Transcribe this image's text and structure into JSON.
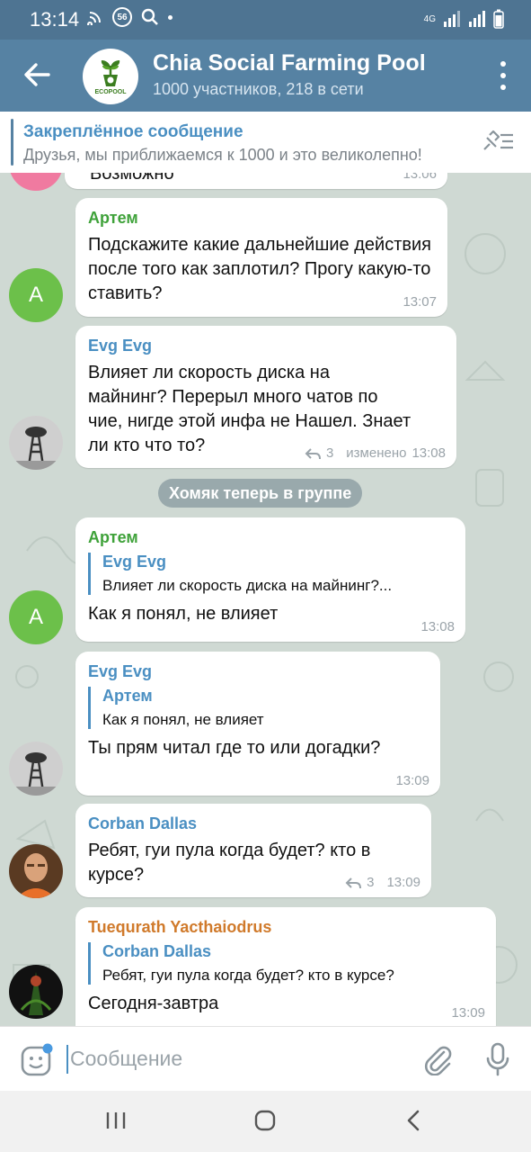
{
  "status_bar": {
    "time": "13:14",
    "indicator": "56",
    "network": "4G"
  },
  "header": {
    "title": "Chia Social Farming Pool",
    "subtitle": "1000 участников, 218 в сети",
    "logo_text": "ECOPOOL"
  },
  "pinned": {
    "title": "Закреплённое сообщение",
    "text": "Друзья, мы приближаемся к 1000 и это великолепно!"
  },
  "partial_top": {
    "text": "Возможно",
    "time": "13:06"
  },
  "messages": [
    {
      "author": "Артем",
      "text": "Подскажите какие дальнейшие действия после того как заплотил? Прогу какую-то ставить?",
      "time": "13:07",
      "avatar_letter": "A"
    },
    {
      "author": "Evg Evg",
      "text": "Влияет ли скорость диска на майнинг? Перерыл много чатов по чие, нигде этой инфа не Нашел. Знает ли кто что то?",
      "replies": "3",
      "edited": "изменено",
      "time": "13:08"
    },
    {
      "author": "Артем",
      "quote_author": "Evg Evg",
      "quote_text": "Влияет ли скорость диска на майнинг?...",
      "text": "Как я понял, не влияет",
      "time": "13:08",
      "avatar_letter": "A"
    },
    {
      "author": "Evg Evg",
      "quote_author": "Артем",
      "quote_text": "Как я понял, не влияет",
      "text": "Ты прям читал где то или догадки?",
      "time": "13:09"
    },
    {
      "author": "Corban Dallas",
      "text": "Ребят, гуи пула когда будет? кто в курсе?",
      "replies": "3",
      "time": "13:09"
    },
    {
      "author": "Tuequrath Yacthaiodrus",
      "quote_author": "Corban Dallas",
      "quote_text": "Ребят, гуи пула когда будет? кто в курсе?",
      "text": "Сегодня-завтра",
      "time": "13:09"
    }
  ],
  "service_message": "Хомяк теперь в группе",
  "input": {
    "placeholder": "Сообщение"
  },
  "colors": {
    "header": "#5682a3",
    "status_bar": "#4e7492",
    "accent": "#4a8fc2",
    "name_green": "#3fa23a",
    "name_orange": "#d07a2b",
    "chat_bg": "#cfd9d3"
  }
}
